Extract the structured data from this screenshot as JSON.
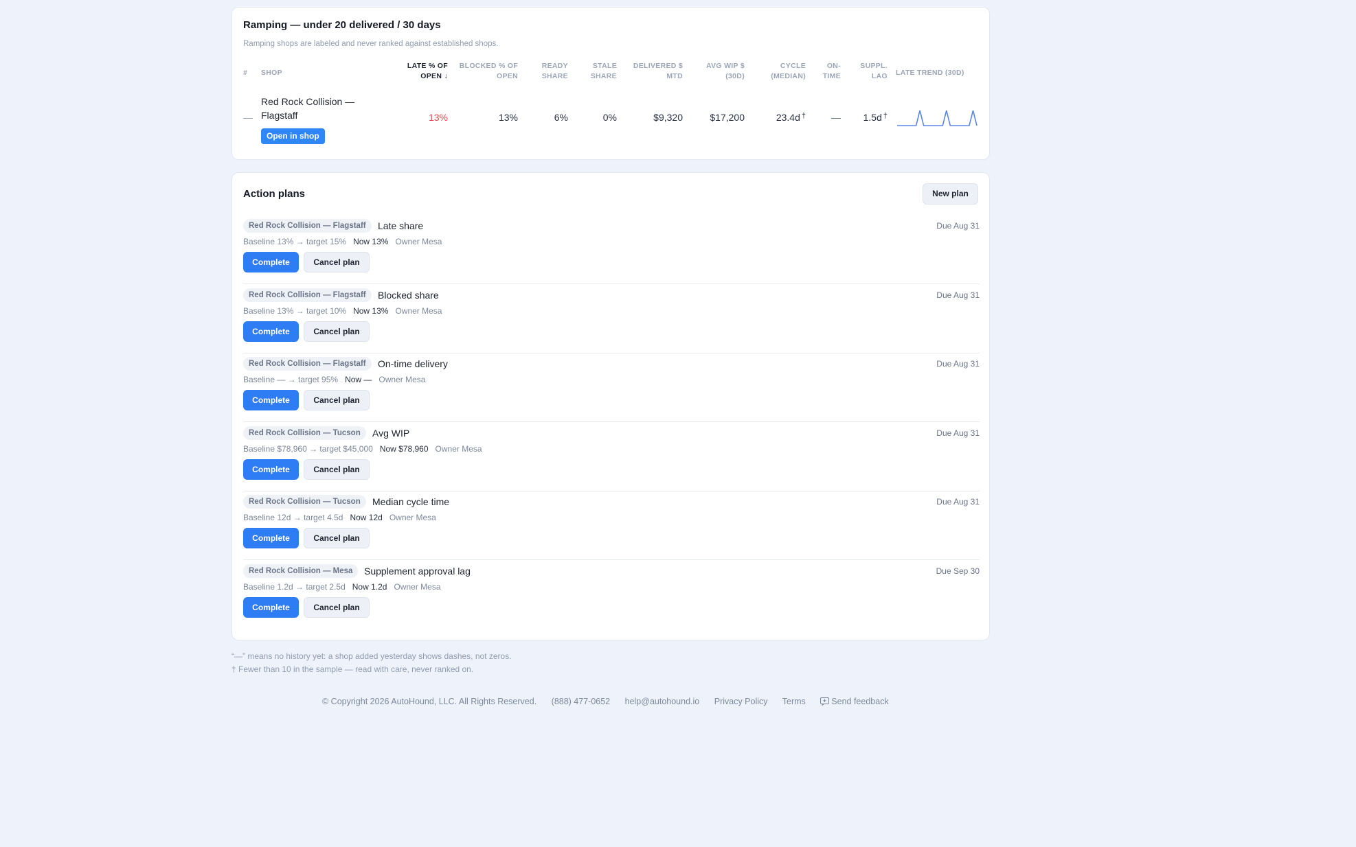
{
  "ramping": {
    "title": "Ramping — under 20 delivered / 30 days",
    "subtitle": "Ramping shops are labeled and never ranked against established shops.",
    "columns": {
      "num": "#",
      "shop": "SHOP",
      "late": [
        "LATE % OF",
        "OPEN ↓"
      ],
      "blocked": [
        "BLOCKED % OF",
        "OPEN"
      ],
      "ready": [
        "READY",
        "SHARE"
      ],
      "stale": [
        "STALE",
        "SHARE"
      ],
      "delivered": [
        "DELIVERED $",
        "MTD"
      ],
      "avg_wip": [
        "AVG WIP $",
        "(30D)"
      ],
      "cycle": [
        "CYCLE",
        "(MEDIAN)"
      ],
      "ontime": [
        "ON-",
        "TIME"
      ],
      "suppl": [
        "SUPPL.",
        "LAG"
      ],
      "trend": "LATE TREND (30D)"
    },
    "row": {
      "num": "—",
      "shop": "Red Rock Collision — Flagstaff",
      "open_button": "Open in shop",
      "late": "13%",
      "blocked": "13%",
      "ready": "6%",
      "stale": "0%",
      "delivered": "$9,320",
      "avg_wip": "$17,200",
      "cycle": "23.4d",
      "cycle_mark": "†",
      "ontime": "—",
      "suppl": "1.5d",
      "suppl_mark": "†",
      "trend_values": [
        0,
        0,
        0,
        0,
        0,
        0,
        1,
        0,
        0,
        0,
        0,
        0,
        0,
        1,
        0,
        0,
        0,
        0,
        0,
        0,
        1,
        0
      ]
    },
    "colors": {
      "late_red": "#e5484d",
      "sparkline": "#5b86e5"
    }
  },
  "action_plans": {
    "title": "Action plans",
    "new_plan": "New plan",
    "complete_label": "Complete",
    "cancel_label": "Cancel plan",
    "plans": [
      {
        "shop": "Red Rock Collision — Flagstaff",
        "metric": "Late share",
        "due": "Due Aug 31",
        "baseline": "Baseline 13% → target 15%",
        "now": "Now 13%",
        "owner": "Owner Mesa"
      },
      {
        "shop": "Red Rock Collision — Flagstaff",
        "metric": "Blocked share",
        "due": "Due Aug 31",
        "baseline": "Baseline 13% → target 10%",
        "now": "Now 13%",
        "owner": "Owner Mesa"
      },
      {
        "shop": "Red Rock Collision — Flagstaff",
        "metric": "On-time delivery",
        "due": "Due Aug 31",
        "baseline": "Baseline — → target 95%",
        "now": "Now —",
        "owner": "Owner Mesa"
      },
      {
        "shop": "Red Rock Collision — Tucson",
        "metric": "Avg WIP",
        "due": "Due Aug 31",
        "baseline": "Baseline $78,960 → target $45,000",
        "now": "Now $78,960",
        "owner": "Owner Mesa"
      },
      {
        "shop": "Red Rock Collision — Tucson",
        "metric": "Median cycle time",
        "due": "Due Aug 31",
        "baseline": "Baseline 12d → target 4.5d",
        "now": "Now 12d",
        "owner": "Owner Mesa"
      },
      {
        "shop": "Red Rock Collision — Mesa",
        "metric": "Supplement approval lag",
        "due": "Due Sep 30",
        "baseline": "Baseline 1.2d → target 2.5d",
        "now": "Now 1.2d",
        "owner": "Owner Mesa"
      }
    ]
  },
  "notes": {
    "dash": "“—” means no history yet: a shop added yesterday shows dashes, not zeros.",
    "dagger": "† Fewer than 10 in the sample — read with care, never ranked on."
  },
  "footer": {
    "copyright": "© Copyright 2026 AutoHound, LLC. All Rights Reserved.",
    "phone": "(888) 477-0652",
    "email": "help@autohound.io",
    "privacy": "Privacy Policy",
    "terms": "Terms",
    "feedback": "Send feedback",
    "feedback_icon": "feedback-icon"
  }
}
